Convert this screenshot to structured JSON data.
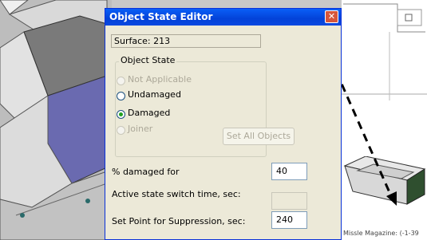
{
  "dialog": {
    "title": "Object State Editor",
    "surface_label": "Surface: 213",
    "group_title": "Object State",
    "options": [
      {
        "label": "Not Applicable",
        "enabled": false,
        "selected": false
      },
      {
        "label": "Undamaged",
        "enabled": true,
        "selected": false
      },
      {
        "label": "Damaged",
        "enabled": true,
        "selected": true
      },
      {
        "label": "Joiner",
        "enabled": false,
        "selected": false
      }
    ],
    "set_all_label": "Set All Objects",
    "percent_damaged": {
      "label": "% damaged for",
      "value": "40"
    },
    "switch_time": {
      "label": "Active state switch time, sec:",
      "value": ""
    },
    "suppression": {
      "label": "Set Point for Suppression, sec:",
      "value": "240"
    }
  },
  "scene": {
    "model_status": "Missle Magazine: (-1-39",
    "selection_color": "#6464b4",
    "damaged_color": "#2f4f2f"
  }
}
